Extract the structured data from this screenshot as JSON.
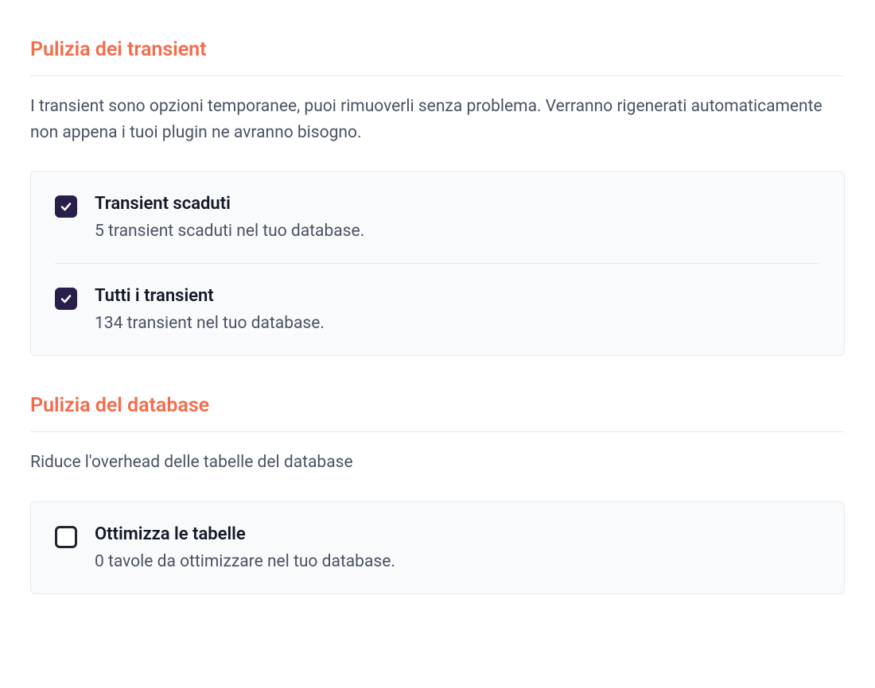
{
  "sections": {
    "transients": {
      "heading": "Pulizia dei transient",
      "description": "I transient sono opzioni temporanee, puoi rimuoverli senza problema. Verranno rigenerati automaticamente non appena i tuoi plugin ne avranno bisogno.",
      "options": {
        "expired": {
          "label": "Transient scaduti",
          "sublabel": "5 transient scaduti nel tuo database.",
          "checked": true
        },
        "all": {
          "label": "Tutti i transient",
          "sublabel": "134 transient nel tuo database.",
          "checked": true
        }
      }
    },
    "database": {
      "heading": "Pulizia del database",
      "description": "Riduce l'overhead delle tabelle del database",
      "options": {
        "optimize": {
          "label": "Ottimizza le tabelle",
          "sublabel": "0 tavole da ottimizzare nel tuo database.",
          "checked": false
        }
      }
    }
  }
}
